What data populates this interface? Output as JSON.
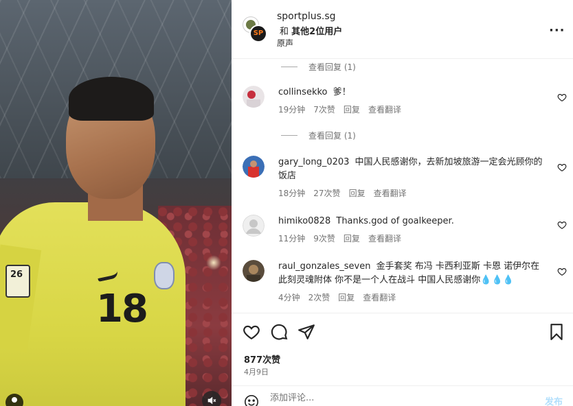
{
  "header": {
    "username": "sportplus.sg",
    "collab_prefix": "和",
    "collab_others": "其他2位用户",
    "audio_label": "原声"
  },
  "view_replies": [
    {
      "label": "查看回复 (1)"
    },
    {
      "label": "查看回复 (1)"
    }
  ],
  "comments": [
    {
      "user": "collinsekko",
      "text": "爹！",
      "time": "19分钟",
      "likes": "7次赞",
      "reply": "回复",
      "translate": "查看翻译"
    },
    {
      "user": "gary_long_0203",
      "text": "中国人民感谢你，去新加坡旅游一定会光顾你的饭店",
      "time": "18分钟",
      "likes": "27次赞",
      "reply": "回复",
      "translate": "查看翻译"
    },
    {
      "user": "himiko0828",
      "text": "Thanks.god of goalkeeper.",
      "time": "11分钟",
      "likes": "9次赞",
      "reply": "回复",
      "translate": "查看翻译"
    },
    {
      "user": "raul_gonzales_seven",
      "text": "金手套奖 布冯 卡西利亚斯 卡恩 诺伊尔在此刻灵魂附体 你不是一个人在战斗 中国人民感谢你💧💧💧",
      "time": "4分钟",
      "likes": "2次赞",
      "reply": "回复",
      "translate": "查看翻译"
    }
  ],
  "post": {
    "likes": "877次赞",
    "date": "4月9日"
  },
  "add_comment": {
    "placeholder": "添加评论...",
    "post_label": "发布"
  },
  "photo": {
    "jersey_number": "18",
    "patch_text": "26"
  },
  "colors": {
    "accent": "#0095f6",
    "post_disabled": "#b2dffc",
    "meta_gray": "#737373",
    "jersey_yellow": "#e3e05a"
  }
}
